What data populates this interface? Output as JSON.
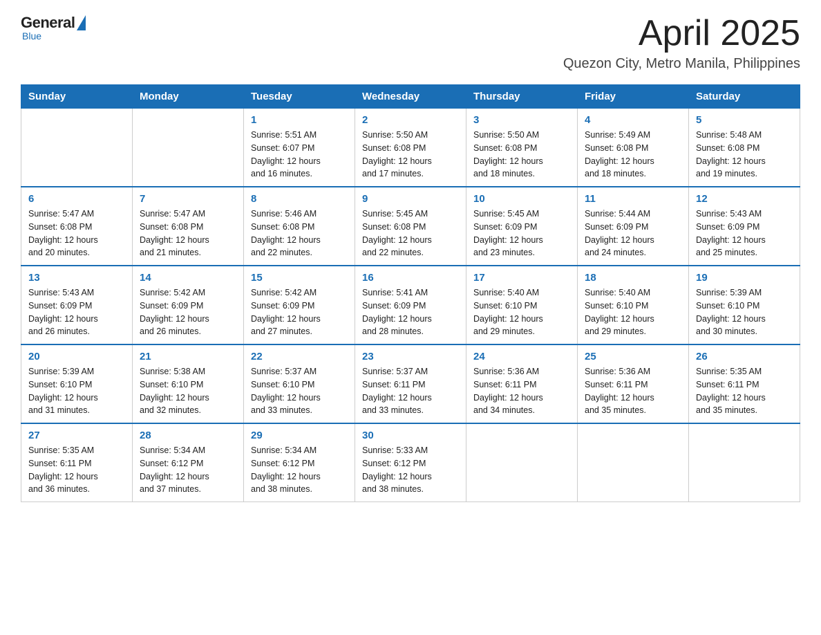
{
  "logo": {
    "general": "General",
    "blue": "Blue",
    "subtitle": "Blue"
  },
  "header": {
    "title": "April 2025",
    "location": "Quezon City, Metro Manila, Philippines"
  },
  "weekdays": [
    "Sunday",
    "Monday",
    "Tuesday",
    "Wednesday",
    "Thursday",
    "Friday",
    "Saturday"
  ],
  "weeks": [
    [
      {
        "day": "",
        "info": ""
      },
      {
        "day": "",
        "info": ""
      },
      {
        "day": "1",
        "info": "Sunrise: 5:51 AM\nSunset: 6:07 PM\nDaylight: 12 hours\nand 16 minutes."
      },
      {
        "day": "2",
        "info": "Sunrise: 5:50 AM\nSunset: 6:08 PM\nDaylight: 12 hours\nand 17 minutes."
      },
      {
        "day": "3",
        "info": "Sunrise: 5:50 AM\nSunset: 6:08 PM\nDaylight: 12 hours\nand 18 minutes."
      },
      {
        "day": "4",
        "info": "Sunrise: 5:49 AM\nSunset: 6:08 PM\nDaylight: 12 hours\nand 18 minutes."
      },
      {
        "day": "5",
        "info": "Sunrise: 5:48 AM\nSunset: 6:08 PM\nDaylight: 12 hours\nand 19 minutes."
      }
    ],
    [
      {
        "day": "6",
        "info": "Sunrise: 5:47 AM\nSunset: 6:08 PM\nDaylight: 12 hours\nand 20 minutes."
      },
      {
        "day": "7",
        "info": "Sunrise: 5:47 AM\nSunset: 6:08 PM\nDaylight: 12 hours\nand 21 minutes."
      },
      {
        "day": "8",
        "info": "Sunrise: 5:46 AM\nSunset: 6:08 PM\nDaylight: 12 hours\nand 22 minutes."
      },
      {
        "day": "9",
        "info": "Sunrise: 5:45 AM\nSunset: 6:08 PM\nDaylight: 12 hours\nand 22 minutes."
      },
      {
        "day": "10",
        "info": "Sunrise: 5:45 AM\nSunset: 6:09 PM\nDaylight: 12 hours\nand 23 minutes."
      },
      {
        "day": "11",
        "info": "Sunrise: 5:44 AM\nSunset: 6:09 PM\nDaylight: 12 hours\nand 24 minutes."
      },
      {
        "day": "12",
        "info": "Sunrise: 5:43 AM\nSunset: 6:09 PM\nDaylight: 12 hours\nand 25 minutes."
      }
    ],
    [
      {
        "day": "13",
        "info": "Sunrise: 5:43 AM\nSunset: 6:09 PM\nDaylight: 12 hours\nand 26 minutes."
      },
      {
        "day": "14",
        "info": "Sunrise: 5:42 AM\nSunset: 6:09 PM\nDaylight: 12 hours\nand 26 minutes."
      },
      {
        "day": "15",
        "info": "Sunrise: 5:42 AM\nSunset: 6:09 PM\nDaylight: 12 hours\nand 27 minutes."
      },
      {
        "day": "16",
        "info": "Sunrise: 5:41 AM\nSunset: 6:09 PM\nDaylight: 12 hours\nand 28 minutes."
      },
      {
        "day": "17",
        "info": "Sunrise: 5:40 AM\nSunset: 6:10 PM\nDaylight: 12 hours\nand 29 minutes."
      },
      {
        "day": "18",
        "info": "Sunrise: 5:40 AM\nSunset: 6:10 PM\nDaylight: 12 hours\nand 29 minutes."
      },
      {
        "day": "19",
        "info": "Sunrise: 5:39 AM\nSunset: 6:10 PM\nDaylight: 12 hours\nand 30 minutes."
      }
    ],
    [
      {
        "day": "20",
        "info": "Sunrise: 5:39 AM\nSunset: 6:10 PM\nDaylight: 12 hours\nand 31 minutes."
      },
      {
        "day": "21",
        "info": "Sunrise: 5:38 AM\nSunset: 6:10 PM\nDaylight: 12 hours\nand 32 minutes."
      },
      {
        "day": "22",
        "info": "Sunrise: 5:37 AM\nSunset: 6:10 PM\nDaylight: 12 hours\nand 33 minutes."
      },
      {
        "day": "23",
        "info": "Sunrise: 5:37 AM\nSunset: 6:11 PM\nDaylight: 12 hours\nand 33 minutes."
      },
      {
        "day": "24",
        "info": "Sunrise: 5:36 AM\nSunset: 6:11 PM\nDaylight: 12 hours\nand 34 minutes."
      },
      {
        "day": "25",
        "info": "Sunrise: 5:36 AM\nSunset: 6:11 PM\nDaylight: 12 hours\nand 35 minutes."
      },
      {
        "day": "26",
        "info": "Sunrise: 5:35 AM\nSunset: 6:11 PM\nDaylight: 12 hours\nand 35 minutes."
      }
    ],
    [
      {
        "day": "27",
        "info": "Sunrise: 5:35 AM\nSunset: 6:11 PM\nDaylight: 12 hours\nand 36 minutes."
      },
      {
        "day": "28",
        "info": "Sunrise: 5:34 AM\nSunset: 6:12 PM\nDaylight: 12 hours\nand 37 minutes."
      },
      {
        "day": "29",
        "info": "Sunrise: 5:34 AM\nSunset: 6:12 PM\nDaylight: 12 hours\nand 38 minutes."
      },
      {
        "day": "30",
        "info": "Sunrise: 5:33 AM\nSunset: 6:12 PM\nDaylight: 12 hours\nand 38 minutes."
      },
      {
        "day": "",
        "info": ""
      },
      {
        "day": "",
        "info": ""
      },
      {
        "day": "",
        "info": ""
      }
    ]
  ]
}
